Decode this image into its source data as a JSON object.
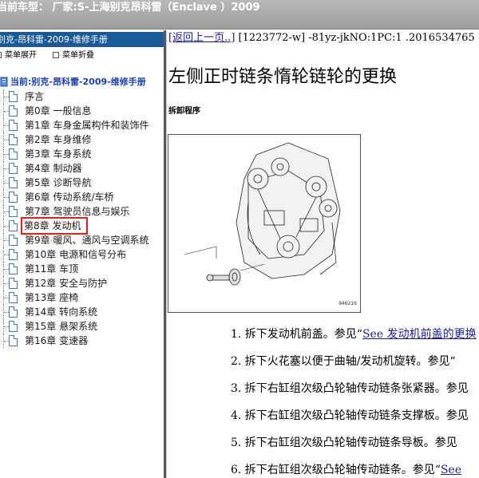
{
  "topbar": {
    "title": "当前车型：  厂家:S-上海别克昂科雷（Enclave ）2009"
  },
  "leftpanel": {
    "header": "别克-昂科雷-2009-维修手册",
    "tools": {
      "expand": "菜单展开",
      "collapse": "菜单折叠"
    },
    "root": "当前:别克-昂科雷-2009-维修手册",
    "items": [
      {
        "label": "序言"
      },
      {
        "label": "第0章  一般信息"
      },
      {
        "label": "第1章  车身金属构件和装饰件"
      },
      {
        "label": "第2章  车身维修"
      },
      {
        "label": "第3章  车身系统"
      },
      {
        "label": "第4章  制动器"
      },
      {
        "label": "第5章  诊断导航"
      },
      {
        "label": "第6章  传动系统/车桥"
      },
      {
        "label": "第7章  驾驶员信息与娱乐"
      },
      {
        "label": "第8章  发动机"
      },
      {
        "label": "第9章  暖风、通风与空调系统"
      },
      {
        "label": "第10章  电源和信号分布"
      },
      {
        "label": "第11章  车顶"
      },
      {
        "label": "第12章  安全与防护"
      },
      {
        "label": "第13章  座椅"
      },
      {
        "label": "第14章  转向系统"
      },
      {
        "label": "第15章  悬架系统"
      },
      {
        "label": "第16章  变速器"
      }
    ],
    "selected_index": 9
  },
  "content": {
    "back_link": "[返回上一页..]",
    "doc_ref": " [1223772-w] -81yz-jkNO:1PC:1 .2016534765",
    "title": "左侧正时链条惰轮链轮的更换",
    "section": "拆卸程序",
    "figure_number": "946216",
    "steps": [
      {
        "text": "1. 拆下发动机前盖。参见“",
        "link": "See 发动机前盖的更换"
      },
      {
        "text": "2. 拆下火花塞以便于曲轴/发动机旋转。参见“",
        "link": ""
      },
      {
        "text": "3. 拆下右缸组次级凸轮轴传动链条张紧器。参见",
        "link": ""
      },
      {
        "text": "4. 拆下右缸组次级凸轮轴传动链条支撑板。参见",
        "link": ""
      },
      {
        "text": "5. 拆下右缸组次级凸轮轴传动链条导板。参见",
        "link": ""
      },
      {
        "text": "6. 拆下右缸组次级凸轮轴传动链条。参见“",
        "link": "See"
      }
    ]
  },
  "colors": {
    "panel_header": "#1a5a98",
    "selection_outline": "#e02020",
    "link": "#1a1aa0"
  }
}
